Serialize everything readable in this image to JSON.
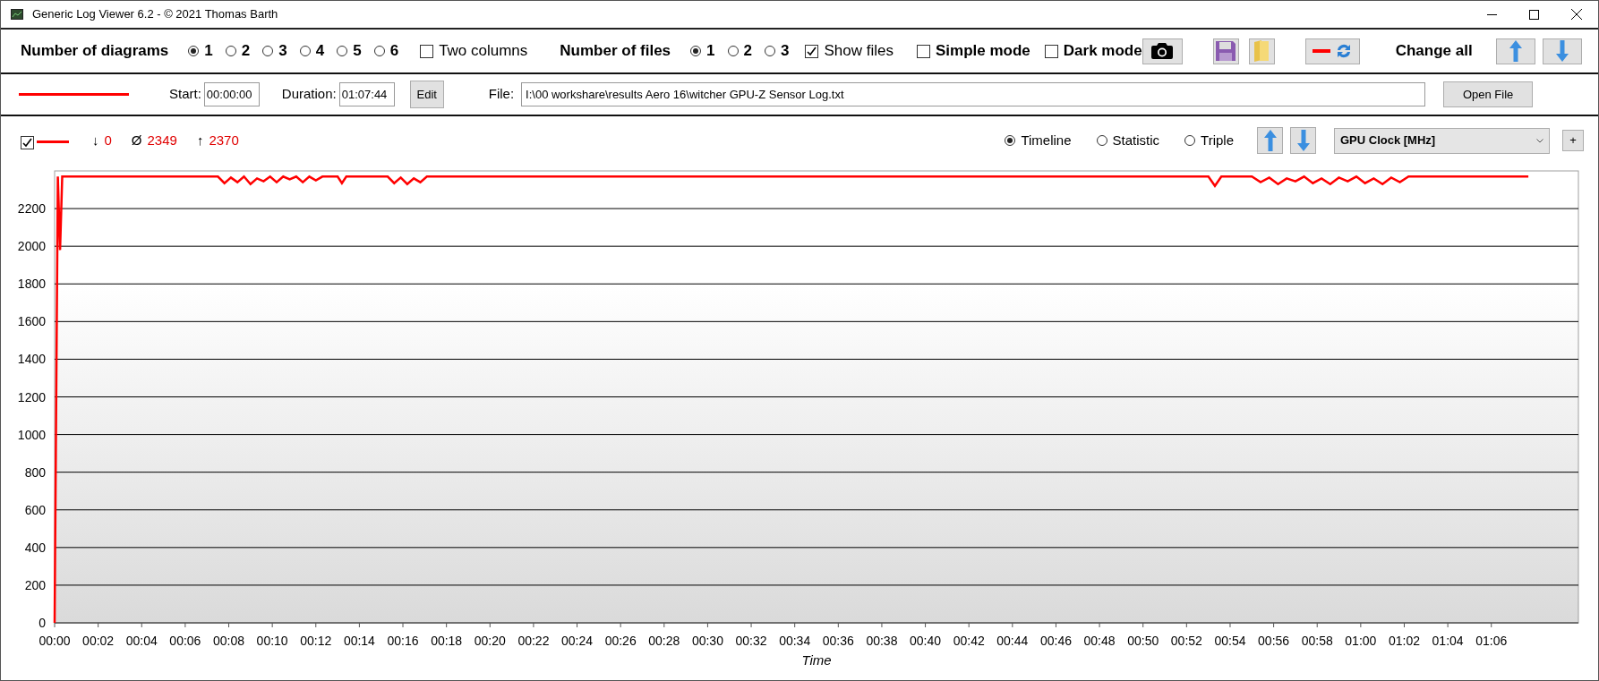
{
  "window": {
    "title": "Generic Log Viewer 6.2 - © 2021 Thomas Barth"
  },
  "toolbar": {
    "diagrams": {
      "label": "Number of diagrams",
      "options": [
        {
          "label": "1",
          "selected": true
        },
        {
          "label": "2",
          "selected": false
        },
        {
          "label": "3",
          "selected": false
        },
        {
          "label": "4",
          "selected": false
        },
        {
          "label": "5",
          "selected": false
        },
        {
          "label": "6",
          "selected": false
        }
      ]
    },
    "two_columns": {
      "label": "Two columns",
      "checked": false
    },
    "files": {
      "label": "Number of files",
      "options": [
        {
          "label": "1",
          "selected": true
        },
        {
          "label": "2",
          "selected": false
        },
        {
          "label": "3",
          "selected": false
        }
      ]
    },
    "show_files": {
      "label": "Show files",
      "checked": true
    },
    "simple_mode": {
      "label": "Simple mode",
      "checked": false
    },
    "dark_mode": {
      "label": "Dark mode",
      "checked": false
    },
    "change_all": "Change all"
  },
  "file_row": {
    "start_label": "Start:",
    "start": "00:00:00",
    "duration_label": "Duration:",
    "duration": "01:07:44",
    "edit_button": "Edit",
    "file_label": "File:",
    "file_path": "I:\\00 workshare\\results Aero 16\\witcher GPU-Z Sensor Log.txt",
    "open_button": "Open File"
  },
  "diagram": {
    "visible": true,
    "stats": [
      {
        "symbol": "↓",
        "value": "0"
      },
      {
        "symbol": "Ø",
        "value": "2349"
      },
      {
        "symbol": "↑",
        "value": "2370"
      }
    ],
    "views": [
      {
        "label": "Timeline",
        "selected": true
      },
      {
        "label": "Statistic",
        "selected": false
      },
      {
        "label": "Triple",
        "selected": false
      }
    ],
    "add_button": "+",
    "chart_data": {
      "type": "line",
      "grid": true,
      "xlabel": "Time",
      "xlim": [
        0,
        70
      ],
      "ylim": [
        0,
        2400
      ],
      "yticks": [
        0,
        200,
        400,
        600,
        800,
        1000,
        1200,
        1400,
        1600,
        1800,
        2000,
        2200
      ],
      "xticks": [
        {
          "value": 0,
          "label": "00:00"
        },
        {
          "value": 2,
          "label": "00:02"
        },
        {
          "value": 4,
          "label": "00:04"
        },
        {
          "value": 6,
          "label": "00:06"
        },
        {
          "value": 8,
          "label": "00:08"
        },
        {
          "value": 10,
          "label": "00:10"
        },
        {
          "value": 12,
          "label": "00:12"
        },
        {
          "value": 14,
          "label": "00:14"
        },
        {
          "value": 16,
          "label": "00:16"
        },
        {
          "value": 18,
          "label": "00:18"
        },
        {
          "value": 20,
          "label": "00:20"
        },
        {
          "value": 22,
          "label": "00:22"
        },
        {
          "value": 24,
          "label": "00:24"
        },
        {
          "value": 26,
          "label": "00:26"
        },
        {
          "value": 28,
          "label": "00:28"
        },
        {
          "value": 30,
          "label": "00:30"
        },
        {
          "value": 32,
          "label": "00:32"
        },
        {
          "value": 34,
          "label": "00:34"
        },
        {
          "value": 36,
          "label": "00:36"
        },
        {
          "value": 38,
          "label": "00:38"
        },
        {
          "value": 40,
          "label": "00:40"
        },
        {
          "value": 42,
          "label": "00:42"
        },
        {
          "value": 44,
          "label": "00:44"
        },
        {
          "value": 46,
          "label": "00:46"
        },
        {
          "value": 48,
          "label": "00:48"
        },
        {
          "value": 50,
          "label": "00:50"
        },
        {
          "value": 52,
          "label": "00:52"
        },
        {
          "value": 54,
          "label": "00:54"
        },
        {
          "value": 56,
          "label": "00:56"
        },
        {
          "value": 58,
          "label": "00:58"
        },
        {
          "value": 60,
          "label": "01:00"
        },
        {
          "value": 62,
          "label": "01:02"
        },
        {
          "value": 64,
          "label": "01:04"
        },
        {
          "value": 66,
          "label": "01:06"
        }
      ],
      "x": [
        0,
        0.15,
        0.25,
        0.35,
        0.5,
        7.5,
        7.8,
        8.1,
        8.4,
        8.7,
        9.0,
        9.3,
        9.6,
        9.9,
        10.2,
        10.5,
        10.8,
        11.1,
        11.4,
        11.7,
        12.0,
        12.3,
        13.0,
        13.2,
        13.4,
        15.3,
        15.6,
        15.9,
        16.2,
        16.5,
        16.8,
        17.1,
        53.0,
        53.3,
        53.6,
        55.0,
        55.4,
        55.8,
        56.2,
        56.6,
        57.0,
        57.4,
        57.8,
        58.2,
        58.6,
        59.0,
        59.4,
        59.8,
        60.2,
        60.6,
        61.0,
        61.4,
        61.8,
        62.2,
        67.7
      ],
      "series": [
        {
          "name": "GPU Clock [MHz]",
          "color": "#ff0000",
          "values": [
            0,
            2370,
            1980,
            2370,
            2370,
            2370,
            2335,
            2365,
            2340,
            2370,
            2330,
            2360,
            2345,
            2370,
            2340,
            2370,
            2355,
            2370,
            2340,
            2370,
            2350,
            2370,
            2370,
            2335,
            2370,
            2370,
            2335,
            2365,
            2330,
            2360,
            2340,
            2370,
            2370,
            2320,
            2370,
            2370,
            2340,
            2365,
            2330,
            2360,
            2345,
            2370,
            2335,
            2360,
            2330,
            2365,
            2345,
            2370,
            2335,
            2360,
            2330,
            2365,
            2340,
            2370,
            2370
          ]
        }
      ]
    }
  }
}
